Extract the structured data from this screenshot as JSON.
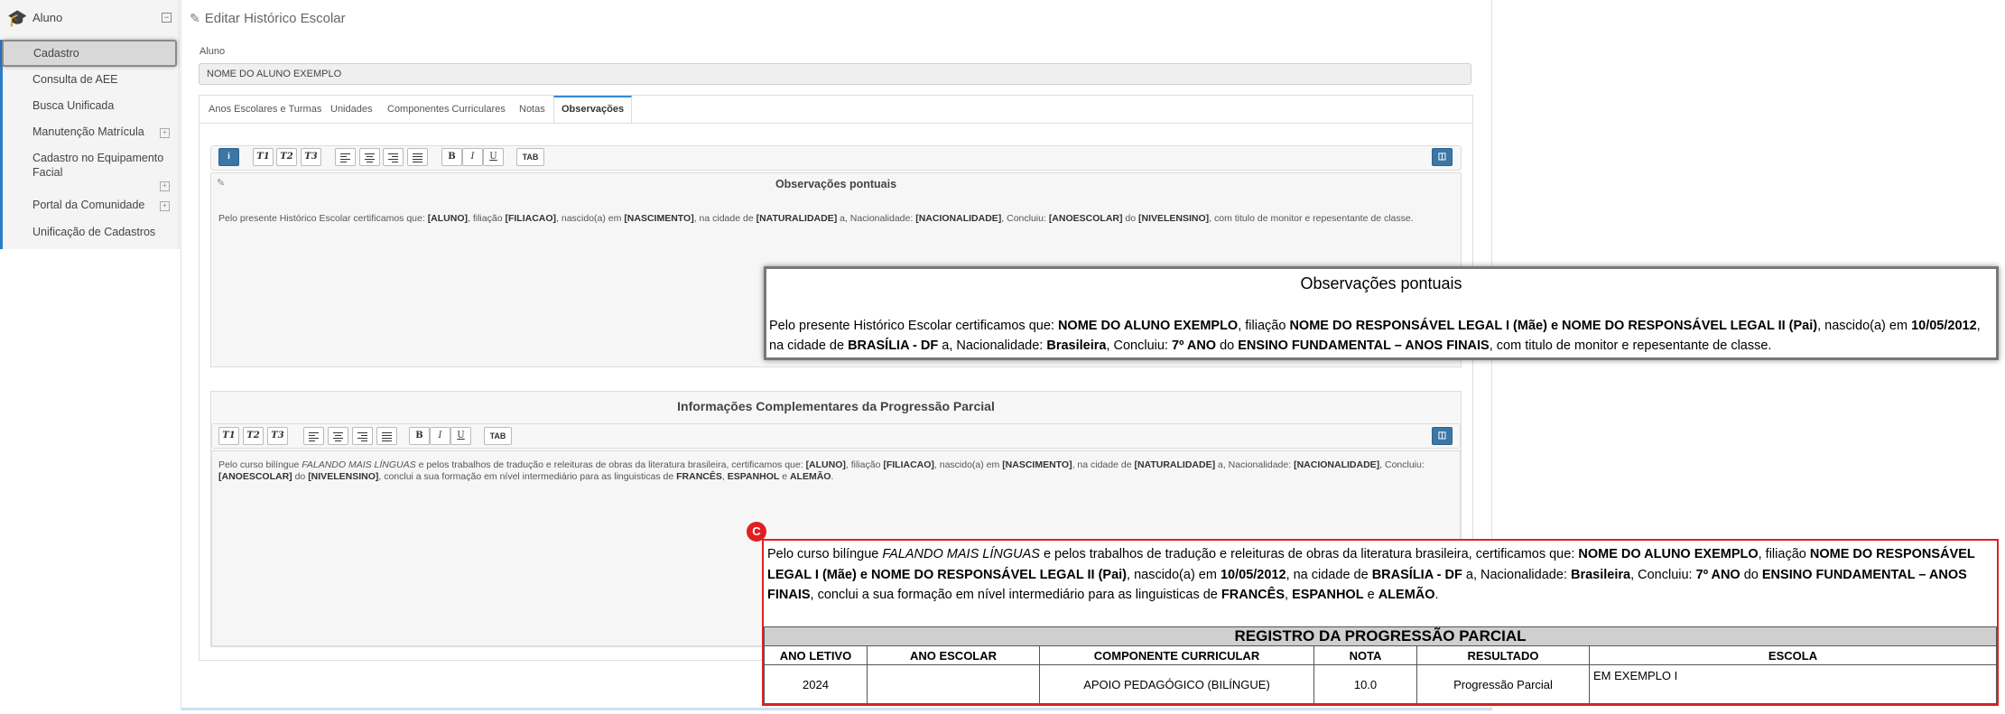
{
  "sidebar": {
    "header_label": "Aluno",
    "items": [
      {
        "label": "Cadastro"
      },
      {
        "label": "Consulta de AEE"
      },
      {
        "label": "Busca Unificada"
      },
      {
        "label": "Manutenção Matrícula"
      },
      {
        "label": "Cadastro no Equipamento Facial"
      },
      {
        "label": "Portal da Comunidade"
      },
      {
        "label": "Unificação de Cadastros"
      }
    ]
  },
  "page": {
    "title": "Editar Histórico Escolar",
    "student_label": "Aluno",
    "student_value": "NOME DO ALUNO EXEMPLO"
  },
  "tabs": [
    {
      "label": "Anos Escolares e Turmas"
    },
    {
      "label": "Unidades"
    },
    {
      "label": "Componentes Curriculares"
    },
    {
      "label": "Notas"
    },
    {
      "label": "Observações"
    }
  ],
  "toolbar": {
    "t1": "T1",
    "t2": "T2",
    "t3": "T3",
    "bold": "B",
    "italic": "I",
    "underline": "U",
    "tab": "TAB",
    "info": "i"
  },
  "editor1": {
    "title": "Observações pontuais",
    "text_parts": [
      "Pelo presente Histórico Escolar certificamos que: ",
      "[ALUNO]",
      ", filiação ",
      "[FILIACAO]",
      ", nascido(a) em ",
      "[NASCIMENTO]",
      ", na cidade de ",
      "[NATURALIDADE]",
      " a, Nacionalidade: ",
      "[NACIONALIDADE]",
      ", Concluiu: ",
      "[ANOESCOLAR]",
      " do ",
      "[NIVELENSINO]",
      ", com titulo de monitor e repesentante de classe."
    ]
  },
  "editor2": {
    "title": "Informações Complementares da Progressão Parcial",
    "text_parts": [
      "Pelo curso bilíngue ",
      "FALANDO MAIS LÍNGUAS",
      " e pelos trabalhos de tradução e releituras de obras da literatura brasileira, certificamos que: ",
      "[ALUNO]",
      ", filiação ",
      "[FILIACAO]",
      ", nascido(a) em ",
      "[NASCIMENTO]",
      ", na cidade de ",
      "[NATURALIDADE]",
      " a, Nacionalidade: ",
      "[NACIONALIDADE]",
      ", Concluiu: ",
      "[ANOESCOLAR]",
      " do ",
      "[NIVELENSINO]",
      ", conclui a sua formação em nível intermediário para as linguisticas de ",
      "FRANCÊS",
      ", ",
      "ESPANHOL",
      " e ",
      "ALEMÃO",
      "."
    ]
  },
  "preview1": {
    "title": "Observações pontuais",
    "parts": [
      "Pelo presente Histórico Escolar certificamos que: ",
      "NOME DO ALUNO EXEMPLO",
      ", filiação ",
      "NOME DO RESPONSÁVEL LEGAL I (Mãe) e NOME DO RESPONSÁVEL LEGAL II (Pai)",
      ", nascido(a) em ",
      "10/05/2012",
      ", na cidade de ",
      "BRASÍLIA - DF",
      " a, Nacionalidade: ",
      "Brasileira",
      ", Concluiu: ",
      "7º ANO",
      " do ",
      "ENSINO FUNDAMENTAL – ANOS FINAIS",
      ", com titulo de monitor e repesentante de classe."
    ]
  },
  "preview2": {
    "badge": "C",
    "parts": [
      "Pelo curso bilíngue ",
      "FALANDO MAIS LÍNGUAS",
      "  e pelos trabalhos de tradução e releituras de obras da literatura brasileira, certificamos que: ",
      "NOME DO ALUNO EXEMPLO",
      ", filiação ",
      "NOME DO RESPONSÁVEL LEGAL I (Mãe) e NOME DO RESPONSÁVEL LEGAL II (Pai)",
      ", nascido(a) em  ",
      "10/05/2012",
      ", na cidade de ",
      "BRASÍLIA - DF",
      " a, Nacionalidade: ",
      "Brasileira",
      ", Concluiu: ",
      "7º ANO",
      " do ",
      "ENSINO FUNDAMENTAL – ANOS FINAIS",
      ",  conclui a sua formação em nível intermediário para as linguisticas de ",
      "FRANCÊS",
      ", ",
      "ESPANHOL",
      " e ",
      "ALEMÃO",
      "."
    ],
    "table": {
      "caption": "REGISTRO DA PROGRESSÃO PARCIAL",
      "headers": [
        "ANO LETIVO",
        "ANO ESCOLAR",
        "COMPONENTE CURRICULAR",
        "NOTA",
        "RESULTADO",
        "ESCOLA"
      ],
      "row": [
        "2024",
        "",
        "APOIO PEDAGÓGICO (BILÍNGUE)",
        "10.0",
        "Progressão Parcial",
        "EM EXEMPLO I"
      ]
    }
  },
  "colors": {
    "accent": "#2b7cc9",
    "info_button": "#3a77a7",
    "highlight_border": "#d22222"
  }
}
